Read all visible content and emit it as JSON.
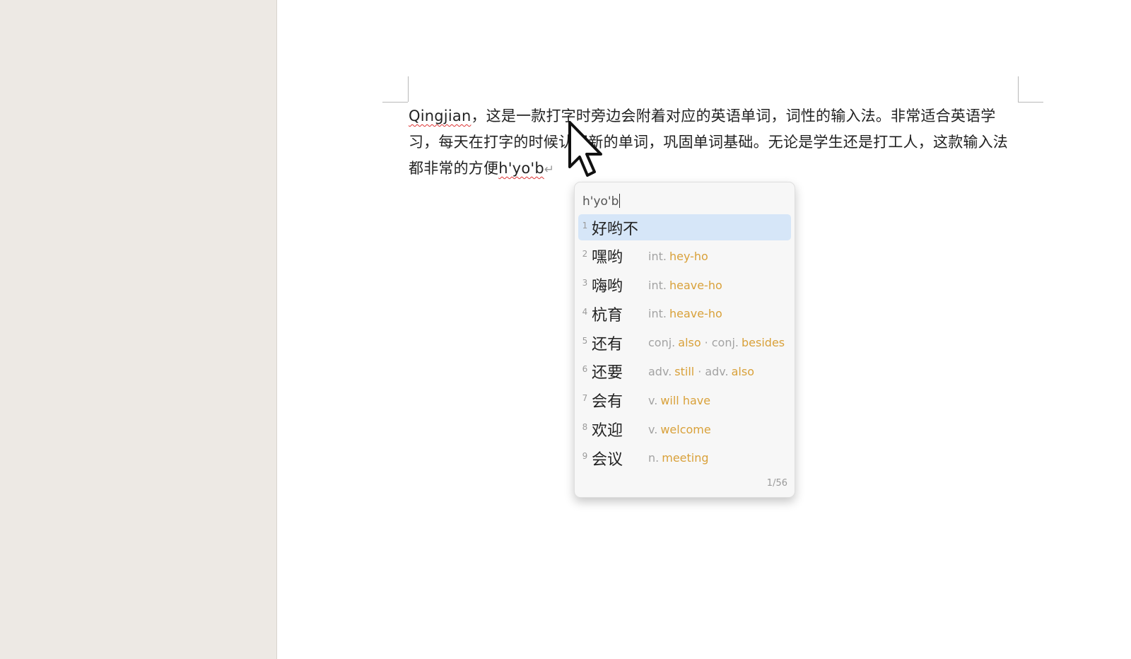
{
  "document": {
    "paragraph": {
      "spelled_word": "Qingjian",
      "rest": "，这是一款打字时旁边会附着对应的英语单词，词性的输入法。非常适合英语学习，每天在打字的时候认识新的单词，巩固单词基础。无论是学生还是打工人，这款输入法都非常的方便",
      "composing": "h'yo'b",
      "para_mark": "↵"
    }
  },
  "ime": {
    "input": "h'yo'b",
    "page": "1/56",
    "candidates": [
      {
        "num": "1",
        "word": "好哟不",
        "gloss": []
      },
      {
        "num": "2",
        "word": "嘿哟",
        "gloss": [
          {
            "pos": "int.",
            "en": "hey-ho"
          }
        ]
      },
      {
        "num": "3",
        "word": "嗨哟",
        "gloss": [
          {
            "pos": "int.",
            "en": "heave-ho"
          }
        ]
      },
      {
        "num": "4",
        "word": "杭育",
        "gloss": [
          {
            "pos": "int.",
            "en": "heave-ho"
          }
        ]
      },
      {
        "num": "5",
        "word": "还有",
        "gloss": [
          {
            "pos": "conj.",
            "en": "also"
          },
          {
            "pos": "conj.",
            "en": "besides"
          }
        ]
      },
      {
        "num": "6",
        "word": "还要",
        "gloss": [
          {
            "pos": "adv.",
            "en": "still"
          },
          {
            "pos": "adv.",
            "en": "also"
          }
        ]
      },
      {
        "num": "7",
        "word": "会有",
        "gloss": [
          {
            "pos": "v.",
            "en": "will have"
          }
        ]
      },
      {
        "num": "8",
        "word": "欢迎",
        "gloss": [
          {
            "pos": "v.",
            "en": "welcome"
          }
        ]
      },
      {
        "num": "9",
        "word": "会议",
        "gloss": [
          {
            "pos": "n.",
            "en": "meeting"
          }
        ]
      }
    ],
    "selected_index": 0,
    "gloss_separator": "·"
  },
  "colors": {
    "english_gloss": "#d9a13a",
    "selection": "#d6e6f8",
    "sidebar": "#ede9e4"
  },
  "icons": {
    "mouse_cursor": "arrow-cursor-icon"
  }
}
